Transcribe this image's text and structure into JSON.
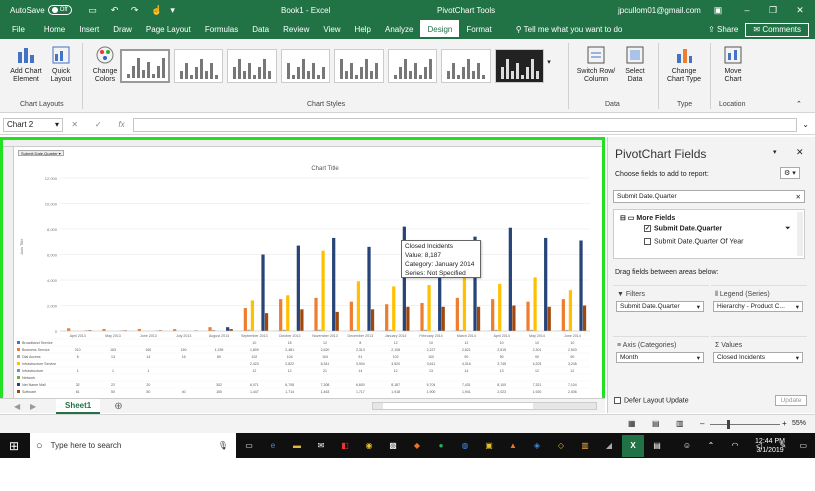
{
  "titlebar": {
    "autosave": "AutoSave",
    "autosave_state": "Off",
    "doc": "Book1  -  Excel",
    "tools": "PivotChart Tools",
    "user": "jpcullom01@gmail.com"
  },
  "tabs": [
    "File",
    "Home",
    "Insert",
    "Draw",
    "Page Layout",
    "Formulas",
    "Data",
    "Review",
    "View",
    "Help",
    "Analyze",
    "Design",
    "Format"
  ],
  "tell_me": "Tell me what you want to do",
  "share": "Share",
  "comments": "Comments",
  "ribbon": {
    "add_chart": "Add Chart Element",
    "quick_layout": "Quick Layout",
    "change_colors": "Change Colors",
    "switch_row": "Switch Row/ Column",
    "select_data": "Select Data",
    "change_type": "Change Chart Type",
    "move_chart": "Move Chart",
    "g_layouts": "Chart Layouts",
    "g_styles": "Chart Styles",
    "g_data": "Data",
    "g_type": "Type",
    "g_location": "Location"
  },
  "namebox": "Chart 2",
  "fx": "fx",
  "chart_data": {
    "type": "bar",
    "title": "Chart Title",
    "ylabel": "Axis Title",
    "ylim": [
      0,
      12000
    ],
    "yticks": [
      "12,000",
      "10,000",
      "8,000",
      "6,000",
      "4,000",
      "2,000",
      "0"
    ],
    "categories": [
      "April 2013",
      "May 2013",
      "June 2013",
      "July 2013",
      "August 2013",
      "September 2013",
      "October 2013",
      "November 2013",
      "December 2013",
      "January 2014",
      "February 2014",
      "March 2014",
      "April 2014",
      "May 2014",
      "June 2014"
    ],
    "series": [
      {
        "name": "Broadband Service",
        "color": "#4472c4",
        "values": [
          0,
          0,
          0,
          0,
          0,
          10,
          15,
          12,
          8,
          12,
          10,
          12,
          10,
          10,
          10
        ]
      },
      {
        "name": "Business Service",
        "color": "#ed7d31",
        "values": [
          210,
          160,
          160,
          150,
          300,
          1800,
          2500,
          2600,
          2300,
          2100,
          2200,
          2600,
          2500,
          2300,
          2500
        ]
      },
      {
        "name": "Dial Access",
        "color": "#a5a5a5",
        "values": [
          0,
          0,
          0,
          0,
          80,
          100,
          100,
          100,
          90,
          100,
          100,
          90,
          90,
          90,
          90
        ]
      },
      {
        "name": "Infrastructure Service",
        "color": "#ffc000",
        "values": [
          0,
          0,
          0,
          0,
          0,
          2400,
          2800,
          6300,
          3900,
          3500,
          3600,
          4300,
          3700,
          4200,
          3200
        ]
      },
      {
        "name": "Infrastructure",
        "color": "#5b9bd5",
        "values": [
          0,
          0,
          0,
          0,
          0,
          0,
          0,
          0,
          0,
          0,
          0,
          0,
          0,
          0,
          0
        ]
      },
      {
        "name": "Network",
        "color": "#70ad47",
        "values": [
          0,
          0,
          0,
          0,
          0,
          0,
          0,
          0,
          0,
          0,
          0,
          0,
          0,
          0,
          0
        ]
      },
      {
        "name": "Net Name Mail",
        "color": "#264478",
        "values": [
          30,
          20,
          20,
          0,
          300,
          6000,
          6700,
          7300,
          6600,
          8187,
          6700,
          7400,
          8100,
          7300,
          7100
        ]
      },
      {
        "name": "Software",
        "color": "#9e480e",
        "values": [
          60,
          50,
          50,
          40,
          150,
          1400,
          1700,
          1500,
          1700,
          1900,
          1900,
          1900,
          2000,
          1900,
          2000
        ]
      }
    ]
  },
  "table": {
    "rows": [
      [
        "Broadband Service",
        "",
        "",
        "",
        "",
        "",
        "10",
        "15",
        "12",
        "8",
        "12",
        "10",
        "12",
        "10",
        "10",
        "10"
      ],
      [
        "Business Service",
        "210",
        "163",
        "160",
        "150",
        "1,159",
        "1,809",
        "2,481",
        "2,620",
        "2,313",
        "2,108",
        "2,227",
        "2,621",
        "2,515",
        "2,301",
        "2,503"
      ],
      [
        "Dial Access",
        "6",
        "13",
        "14",
        "16",
        "80",
        "102",
        "104",
        "104",
        "91",
        "102",
        "100",
        "90",
        "90",
        "90",
        "90"
      ],
      [
        "Infrastructure Service",
        "",
        "",
        "",
        "",
        "",
        "2,423",
        "2,822",
        "6,341",
        "3,904",
        "3,520",
        "3,611",
        "4,316",
        "3,745",
        "4,203",
        "3,245"
      ],
      [
        "Infrastructure",
        "1",
        "1",
        "1",
        "",
        "",
        "12",
        "12",
        "21",
        "14",
        "12",
        "13",
        "14",
        "13",
        "12",
        "12"
      ],
      [
        "Network",
        "",
        "",
        "",
        "",
        "",
        "",
        "",
        "",
        "",
        "",
        "",
        "",
        "",
        "",
        ""
      ],
      [
        "Net Name Mail",
        "32",
        "22",
        "20",
        "",
        "302",
        "6,071",
        "6,708",
        "7,308",
        "6,600",
        "8,187",
        "6,704",
        "7,431",
        "8,100",
        "7,321",
        "7,104"
      ],
      [
        "Software",
        "61",
        "50",
        "50",
        "40",
        "150",
        "1,447",
        "1,714",
        "1,463",
        "1,717",
        "1,918",
        "1,900",
        "1,941",
        "2,023",
        "1,920",
        "2,006"
      ]
    ]
  },
  "tooltip": {
    "l1": "Closed Incidents",
    "l2": "Value: 8,187",
    "l3": "Category: January 2014",
    "l4": "Series: Not Specified"
  },
  "filter_btn": "Submit Date.Quarter",
  "sheet": "Sheet1",
  "pane": {
    "title": "PivotChart Fields",
    "choose": "Choose fields to add to report:",
    "search": "Submit Date.Quarter",
    "more": "More Fields",
    "f1": "Submit Date.Quarter",
    "f2": "Submit Date.Quarter Of Year",
    "drag": "Drag fields between areas below:",
    "filters": "Filters",
    "legend": "Legend (Series)",
    "axis": "Axis (Categories)",
    "values": "Values",
    "filters_val": "Submit Date.Quarter",
    "legend_val": "Hierarchy - Product C...",
    "axis_val": "Month",
    "values_val": "Closed Incidents",
    "defer": "Defer Layout Update",
    "update": "Update"
  },
  "status": {
    "zoom": "55%"
  },
  "taskbar": {
    "search": "Type here to search",
    "time": "12:44 PM",
    "date": "3/1/2019"
  }
}
